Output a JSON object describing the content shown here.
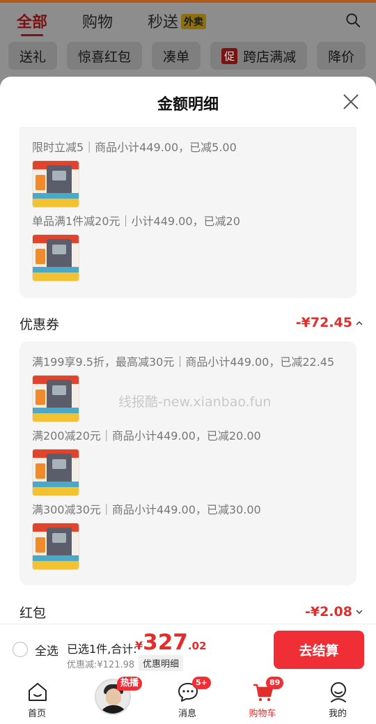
{
  "top_tabs": [
    {
      "label": "全部"
    },
    {
      "label": "购物"
    },
    {
      "label": "秒送",
      "badge": "外卖"
    }
  ],
  "chips": [
    {
      "label": "送礼"
    },
    {
      "label": "惊喜红包"
    },
    {
      "label": "凑单"
    },
    {
      "label": "跨店满减",
      "tag": "促"
    },
    {
      "label": "降价"
    }
  ],
  "sheet": {
    "title": "金额明细",
    "groups": [
      {
        "rules": [
          "限时立减5｜商品小计449.00，已减5.00",
          "单品满1件减20元｜小计449.00，已减20"
        ]
      },
      {
        "rules": [
          "满199享9.5折，最高减30元｜商品小计449.00，已减22.45",
          "满200减20元｜商品小计449.00，已减20.00",
          "满300减30元｜商品小计449.00，已减30.00"
        ]
      }
    ],
    "sections": [
      {
        "label": "优惠券",
        "value": "-¥72.45"
      },
      {
        "label": "红包",
        "value": "-¥2.08"
      }
    ],
    "watermark": "线报酷-new.xianbao.fun"
  },
  "checkout": {
    "select_all": "全选",
    "selected_label": "已选1件,合计:",
    "currency": "¥",
    "total_int": "327",
    "total_dec": ".02",
    "discount": "优惠减:¥121.98",
    "detail_button": "优惠明细",
    "pay_button": "去结算"
  },
  "tabbar": [
    {
      "label": "首页"
    },
    {
      "label": "",
      "badge": "热播"
    },
    {
      "label": "消息",
      "badge": "5+"
    },
    {
      "label": "购物车",
      "badge": "89"
    },
    {
      "label": "我的"
    }
  ],
  "colors": {
    "accent": "#e22d2d",
    "pay": "#ef2f35"
  }
}
